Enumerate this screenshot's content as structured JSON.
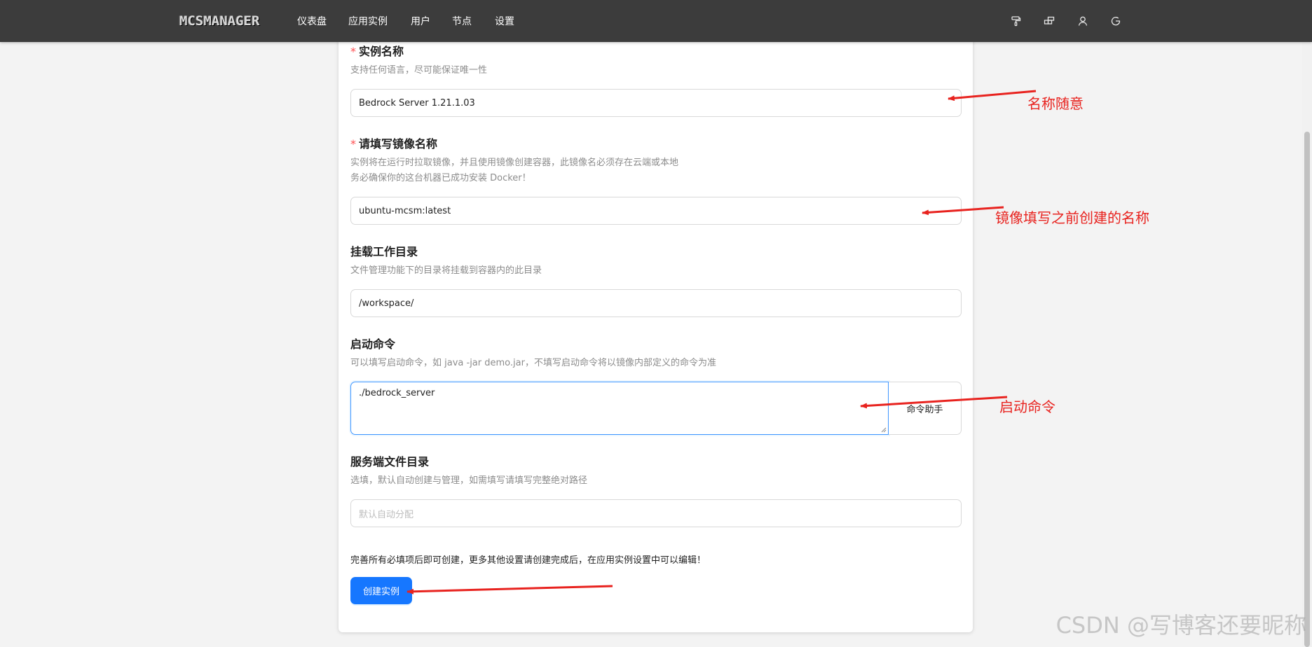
{
  "nav": {
    "logo": "MCSMANAGER",
    "items": [
      "仪表盘",
      "应用实例",
      "用户",
      "节点",
      "设置"
    ],
    "icons": [
      "paint-roller-icon",
      "layout-icon",
      "user-icon",
      "logout-icon"
    ]
  },
  "form": {
    "name": {
      "required_mark": "*",
      "label": "实例名称",
      "desc": "支持任何语言，尽可能保证唯一性",
      "value": "Bedrock Server 1.21.1.03"
    },
    "image": {
      "required_mark": "*",
      "label": "请填写镜像名称",
      "desc_line1": "实例将在运行时拉取镜像，并且使用镜像创建容器，此镜像名必须存在云端或本地",
      "desc_line2": "务必确保你的这台机器已成功安装 Docker！",
      "value": "ubuntu-mcsm:latest"
    },
    "workdir": {
      "label": "挂载工作目录",
      "desc": "文件管理功能下的目录将挂载到容器内的此目录",
      "value": "/workspace/"
    },
    "command": {
      "label": "启动命令",
      "desc": "可以填写启动命令，如 java -jar demo.jar，不填写启动命令将以镜像内部定义的命令为准",
      "value": "./bedrock_server",
      "helper_button": "命令助手"
    },
    "server_dir": {
      "label": "服务端文件目录",
      "desc": "选填，默认自动创建与管理，如需填写请填写完整绝对路径",
      "placeholder": "默认自动分配"
    },
    "note": "完善所有必填项后即可创建，更多其他设置请创建完成后，在应用实例设置中可以编辑！",
    "submit_label": "创建实例"
  },
  "annotations": {
    "name_hint": "名称随意",
    "image_hint": "镜像填写之前创建的名称",
    "command_hint": "启动命令",
    "color": "#e8231f"
  },
  "watermark": "CSDN @写博客还要昵称"
}
